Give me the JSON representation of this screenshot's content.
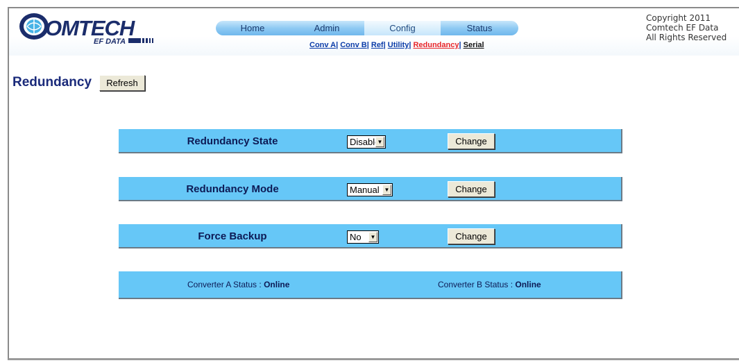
{
  "brand": {
    "logo_text": "OMTECH",
    "logo_sub": "EF DATA",
    "colors": {
      "logo_navy": "#1b2d6b",
      "logo_cyan": "#47b3e6"
    }
  },
  "nav": {
    "tabs": [
      {
        "label": "Home"
      },
      {
        "label": "Admin"
      },
      {
        "label": "Config"
      },
      {
        "label": "Status"
      }
    ],
    "active_tab": "Config"
  },
  "subnav": {
    "links": [
      {
        "label": "Conv A"
      },
      {
        "label": "Conv B"
      },
      {
        "label": "Ref"
      },
      {
        "label": "Utility"
      },
      {
        "label": "Redundancy"
      },
      {
        "label": "Serial"
      }
    ],
    "separator": "|",
    "current": "Redundancy"
  },
  "copyright": {
    "line1": "Copyright 2011",
    "line2": "Comtech EF Data",
    "line3": "All Rights Reserved"
  },
  "page": {
    "title": "Redundancy",
    "refresh_label": "Refresh"
  },
  "settings": {
    "redundancy_state": {
      "label": "Redundancy State",
      "value": "Disable",
      "change_label": "Change"
    },
    "redundancy_mode": {
      "label": "Redundancy Mode",
      "value": "Manual",
      "change_label": "Change"
    },
    "force_backup": {
      "label": "Force Backup",
      "value": "No",
      "change_label": "Change"
    }
  },
  "status": {
    "conv_a_label": "Converter A Status :",
    "conv_a_value": "Online",
    "conv_b_label": "Converter B Status :",
    "conv_b_value": "Online"
  },
  "colors": {
    "panel": "#66c7f7",
    "heading": "#1a2a7a",
    "link": "#0b3ca8",
    "link_current": "#e8262a"
  }
}
